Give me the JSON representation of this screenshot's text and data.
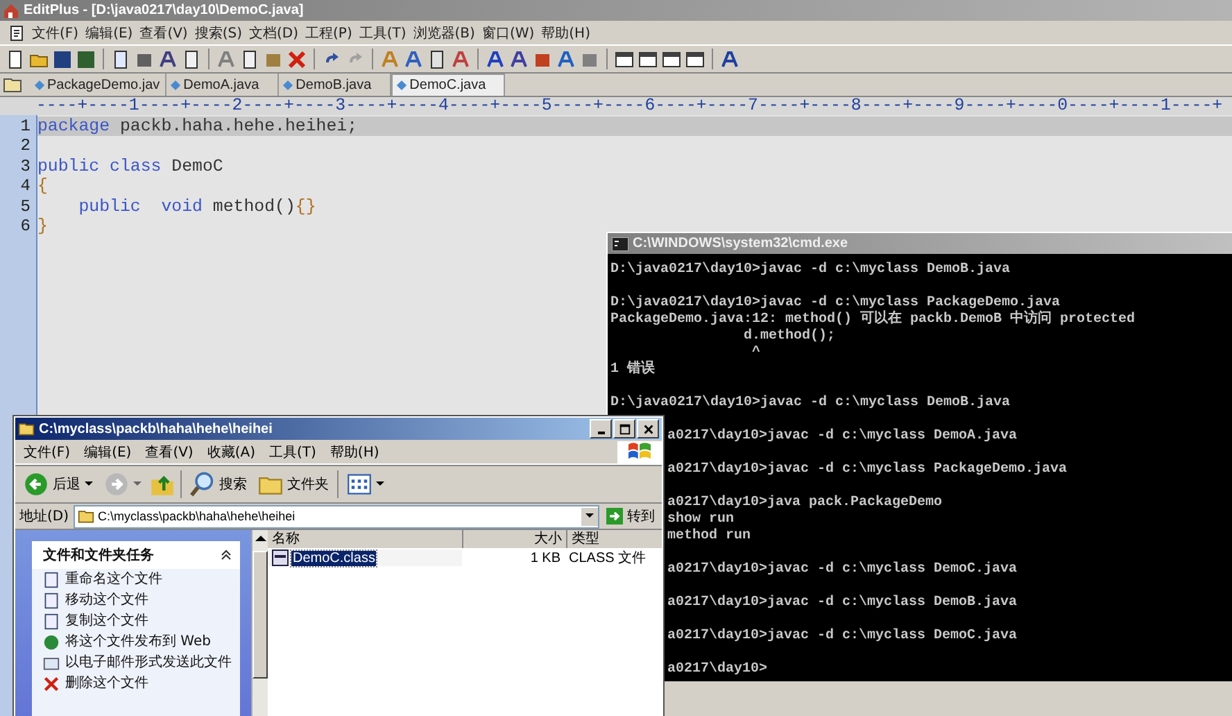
{
  "editplus": {
    "title": "EditPlus - [D:\\java0217\\day10\\DemoC.java]",
    "menu": [
      "文件(F)",
      "编辑(E)",
      "查看(V)",
      "搜索(S)",
      "文档(D)",
      "工程(P)",
      "工具(T)",
      "浏览器(B)",
      "窗口(W)",
      "帮助(H)"
    ],
    "tabs": [
      {
        "label": "PackageDemo.jav",
        "selected": false
      },
      {
        "label": "DemoA.java",
        "selected": false
      },
      {
        "label": "DemoB.java",
        "selected": false
      },
      {
        "label": "DemoC.java",
        "selected": true
      }
    ],
    "ruler": "----+----1----+----2----+----3----+----4----+----5----+----6----+----7----+----8----+----9----+----0----+----1----+",
    "lines": [
      {
        "number": "1",
        "current": true,
        "tokens": [
          {
            "kind": "keyword",
            "text": "package"
          },
          {
            "kind": "plain",
            "text": " packb.haha.hehe.heihei;"
          }
        ]
      },
      {
        "number": "2",
        "current": false
      },
      {
        "number": "3",
        "current": false,
        "tokens": [
          {
            "kind": "keyword",
            "text": "public class"
          },
          {
            "kind": "plain",
            "text": " DemoC"
          }
        ]
      },
      {
        "number": "4",
        "current": false,
        "tokens": [
          {
            "kind": "brace",
            "text": "{"
          }
        ]
      },
      {
        "number": "5",
        "current": false,
        "tokens": [
          {
            "kind": "keyword",
            "text": "    public  void"
          },
          {
            "kind": "plain",
            "text": " method()"
          },
          {
            "kind": "brace",
            "text": "{}"
          }
        ]
      },
      {
        "number": "6",
        "current": false,
        "tokens": [
          {
            "kind": "brace",
            "text": "}"
          }
        ]
      }
    ]
  },
  "cmd": {
    "title": "C:\\WINDOWS\\system32\\cmd.exe",
    "lines": [
      {
        "kind": "full",
        "text": "D:\\java0217\\day10>javac -d c:\\myclass DemoB.java"
      },
      {
        "kind": "blank"
      },
      {
        "kind": "full",
        "text": "D:\\java0217\\day10>javac -d c:\\myclass PackageDemo.java"
      },
      {
        "kind": "full",
        "text": "PackageDemo.java:12: method() 可以在 packb.DemoB 中访问 protected"
      },
      {
        "kind": "full",
        "text": "                d.method();"
      },
      {
        "kind": "full",
        "text": "                 ^"
      },
      {
        "kind": "full",
        "text": "1 错误"
      },
      {
        "kind": "blank"
      },
      {
        "kind": "full",
        "text": "D:\\java0217\\day10>javac -d c:\\myclass DemoB.java"
      },
      {
        "kind": "blank"
      },
      {
        "kind": "clipped",
        "text": "a0217\\day10>javac -d c:\\myclass DemoA.java"
      },
      {
        "kind": "blank"
      },
      {
        "kind": "clipped",
        "text": "a0217\\day10>javac -d c:\\myclass PackageDemo.java"
      },
      {
        "kind": "blank"
      },
      {
        "kind": "clipped",
        "text": "a0217\\day10>java pack.PackageDemo"
      },
      {
        "kind": "clipped",
        "text": "show run"
      },
      {
        "kind": "clipped",
        "text": "method run"
      },
      {
        "kind": "blank"
      },
      {
        "kind": "clipped",
        "text": "a0217\\day10>javac -d c:\\myclass DemoC.java"
      },
      {
        "kind": "blank"
      },
      {
        "kind": "clipped",
        "text": "a0217\\day10>javac -d c:\\myclass DemoB.java"
      },
      {
        "kind": "blank"
      },
      {
        "kind": "clipped",
        "text": "a0217\\day10>javac -d c:\\myclass DemoC.java"
      },
      {
        "kind": "blank"
      },
      {
        "kind": "clipped",
        "text": "a0217\\day10>"
      }
    ]
  },
  "explorer": {
    "title": "C:\\myclass\\packb\\haha\\hehe\\heihei",
    "menu": [
      "文件(F)",
      "编辑(E)",
      "查看(V)",
      "收藏(A)",
      "工具(T)",
      "帮助(H)"
    ],
    "toolbar": {
      "back": "后退",
      "search": "搜索",
      "folders": "文件夹"
    },
    "address": {
      "label": "地址(D)",
      "value": "C:\\myclass\\packb\\haha\\hehe\\heihei",
      "go": "转到"
    },
    "tasks": {
      "title": "文件和文件夹任务",
      "items": [
        "重命名这个文件",
        "移动这个文件",
        "复制这个文件",
        "将这个文件发布到 Web",
        "以电子邮件形式发送此文件",
        "删除这个文件"
      ]
    },
    "columns": [
      "名称",
      "大小",
      "类型"
    ],
    "files": [
      {
        "name": "DemoC.class",
        "size": "1 KB",
        "type": "CLASS 文件",
        "selected": true
      }
    ]
  }
}
